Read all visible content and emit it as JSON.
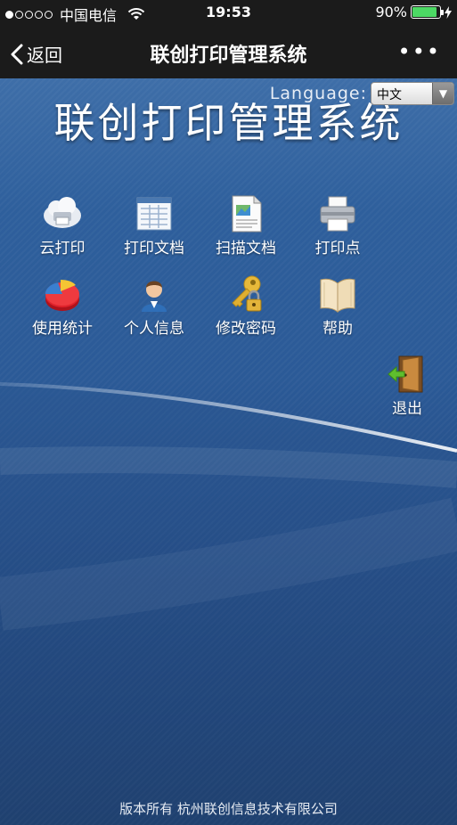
{
  "status_bar": {
    "carrier": "中国电信",
    "time": "19:53",
    "battery_percent": "90%",
    "battery_level": 0.9,
    "signal_filled": 1,
    "signal_total": 5
  },
  "nav": {
    "back_label": "返回",
    "title": "联创打印管理系统",
    "more_label": "•••"
  },
  "page": {
    "title": "联创打印管理系统",
    "language_label": "Language:",
    "language_value": "中文",
    "footer": "版本所有  杭州联创信息技术有限公司"
  },
  "menu": {
    "row1": [
      {
        "label": "云打印",
        "icon": "cloud-print-icon"
      },
      {
        "label": "打印文档",
        "icon": "document-list-icon"
      },
      {
        "label": "扫描文档",
        "icon": "scan-document-icon"
      },
      {
        "label": "打印点",
        "icon": "printer-icon"
      }
    ],
    "row2": [
      {
        "label": "使用统计",
        "icon": "pie-chart-icon"
      },
      {
        "label": "个人信息",
        "icon": "user-icon"
      },
      {
        "label": "修改密码",
        "icon": "key-lock-icon"
      },
      {
        "label": "帮助",
        "icon": "book-icon"
      }
    ],
    "logout": {
      "label": "退出",
      "icon": "exit-door-icon"
    }
  },
  "colors": {
    "bar_background": "#1b1b1b",
    "battery_green": "#4cd964",
    "background_top": "#3e6ea8",
    "background_bottom": "#1a365f"
  }
}
